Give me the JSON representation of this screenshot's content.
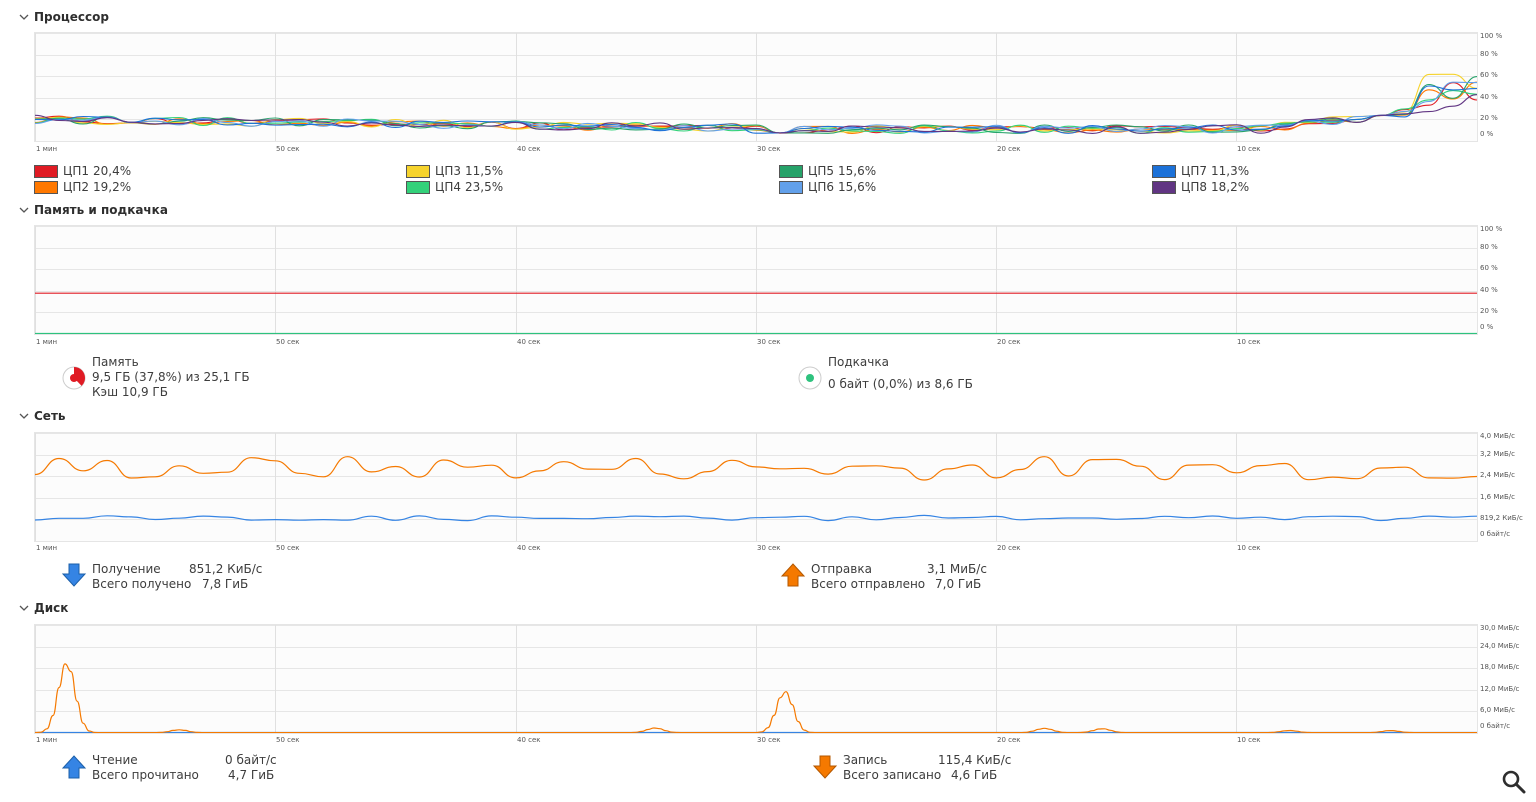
{
  "sections": {
    "cpu": {
      "title": "Процессор"
    },
    "memory": {
      "title": "Память и подкачка"
    },
    "network": {
      "title": "Сеть"
    },
    "disk": {
      "title": "Диск"
    }
  },
  "x_axis_labels": [
    "1 мин",
    "50 сек",
    "40 сек",
    "30 сек",
    "20 сек",
    "10 сек"
  ],
  "cpu": {
    "y_labels": [
      "100 %",
      "80 %",
      "60 %",
      "40 %",
      "20 %",
      "0 %"
    ],
    "cores": [
      {
        "name": "ЦП1",
        "value": "20,4%",
        "color": "#e01b24"
      },
      {
        "name": "ЦП2",
        "value": "19,2%",
        "color": "#ff7800"
      },
      {
        "name": "ЦП3",
        "value": "11,5%",
        "color": "#f6d32d"
      },
      {
        "name": "ЦП4",
        "value": "23,5%",
        "color": "#33d17a"
      },
      {
        "name": "ЦП5",
        "value": "15,6%",
        "color": "#26a269"
      },
      {
        "name": "ЦП6",
        "value": "15,6%",
        "color": "#62a0ea"
      },
      {
        "name": "ЦП7",
        "value": "11,3%",
        "color": "#1c71d8"
      },
      {
        "name": "ЦП8",
        "value": "18,2%",
        "color": "#613583"
      }
    ]
  },
  "memory": {
    "y_labels": [
      "100 %",
      "80 %",
      "60 %",
      "40 %",
      "20 %",
      "0 %"
    ],
    "mem_label": "Память",
    "mem_used": "9,5 ГБ (37,8%) из 25,1 ГБ",
    "mem_cache": "Кэш 10,9 ГБ",
    "mem_fraction": 0.378,
    "swap_label": "Подкачка",
    "swap_used": "0 байт (0,0%) из 8,6 ГБ",
    "swap_fraction": 0.0,
    "mem_color": "#e01b24",
    "swap_color": "#2ec27e"
  },
  "network": {
    "y_labels": [
      "4,0 МиБ/с",
      "3,2 МиБ/с",
      "2,4 МиБ/с",
      "1,6 МиБ/с",
      "819,2 КиБ/с",
      "0 байт/с"
    ],
    "recv_label": "Получение",
    "recv_value": "851,2 КиБ/с",
    "recv_total_label": "Всего получено",
    "recv_total": "7,8 ГиБ",
    "send_label": "Отправка",
    "send_value": "3,1 МиБ/с",
    "send_total_label": "Всего отправлено",
    "send_total": "7,0 ГиБ",
    "recv_color": "#3584e4",
    "send_color": "#f57900"
  },
  "disk": {
    "y_labels": [
      "30,0 МиБ/с",
      "24,0 МиБ/с",
      "18,0 МиБ/с",
      "12,0 МиБ/с",
      "6,0 МиБ/с",
      "0 байт/с"
    ],
    "read_label": "Чтение",
    "read_value": "0 байт/с",
    "read_total_label": "Всего прочитано",
    "read_total": "4,7 ГиБ",
    "write_label": "Запись",
    "write_value": "115,4 КиБ/с",
    "write_total_label": "Всего записано",
    "write_total": "4,6 ГиБ",
    "read_color": "#3584e4",
    "write_color": "#f57900"
  },
  "search": {
    "icon": "search-icon"
  }
}
